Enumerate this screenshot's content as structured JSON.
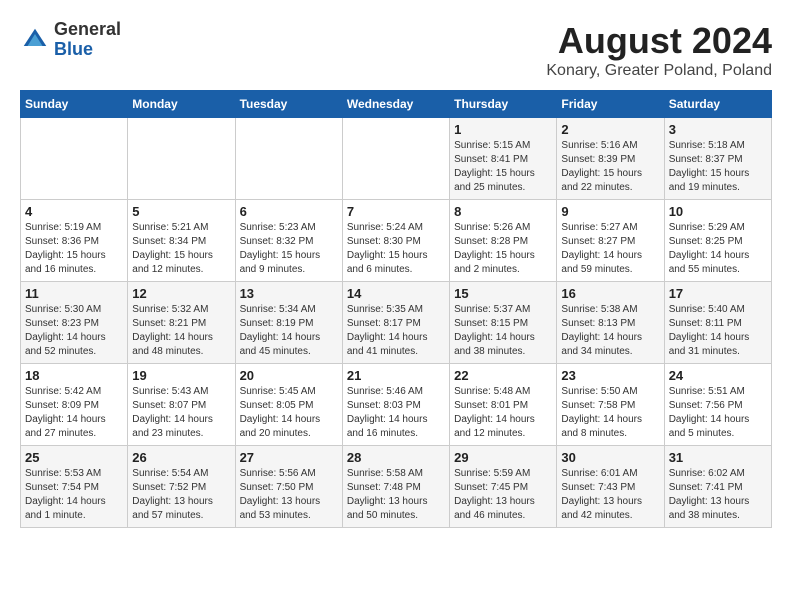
{
  "header": {
    "logo_general": "General",
    "logo_blue": "Blue",
    "title": "August 2024",
    "subtitle": "Konary, Greater Poland, Poland"
  },
  "columns": [
    "Sunday",
    "Monday",
    "Tuesday",
    "Wednesday",
    "Thursday",
    "Friday",
    "Saturday"
  ],
  "weeks": [
    [
      {
        "day": "",
        "info": ""
      },
      {
        "day": "",
        "info": ""
      },
      {
        "day": "",
        "info": ""
      },
      {
        "day": "",
        "info": ""
      },
      {
        "day": "1",
        "info": "Sunrise: 5:15 AM\nSunset: 8:41 PM\nDaylight: 15 hours\nand 25 minutes."
      },
      {
        "day": "2",
        "info": "Sunrise: 5:16 AM\nSunset: 8:39 PM\nDaylight: 15 hours\nand 22 minutes."
      },
      {
        "day": "3",
        "info": "Sunrise: 5:18 AM\nSunset: 8:37 PM\nDaylight: 15 hours\nand 19 minutes."
      }
    ],
    [
      {
        "day": "4",
        "info": "Sunrise: 5:19 AM\nSunset: 8:36 PM\nDaylight: 15 hours\nand 16 minutes."
      },
      {
        "day": "5",
        "info": "Sunrise: 5:21 AM\nSunset: 8:34 PM\nDaylight: 15 hours\nand 12 minutes."
      },
      {
        "day": "6",
        "info": "Sunrise: 5:23 AM\nSunset: 8:32 PM\nDaylight: 15 hours\nand 9 minutes."
      },
      {
        "day": "7",
        "info": "Sunrise: 5:24 AM\nSunset: 8:30 PM\nDaylight: 15 hours\nand 6 minutes."
      },
      {
        "day": "8",
        "info": "Sunrise: 5:26 AM\nSunset: 8:28 PM\nDaylight: 15 hours\nand 2 minutes."
      },
      {
        "day": "9",
        "info": "Sunrise: 5:27 AM\nSunset: 8:27 PM\nDaylight: 14 hours\nand 59 minutes."
      },
      {
        "day": "10",
        "info": "Sunrise: 5:29 AM\nSunset: 8:25 PM\nDaylight: 14 hours\nand 55 minutes."
      }
    ],
    [
      {
        "day": "11",
        "info": "Sunrise: 5:30 AM\nSunset: 8:23 PM\nDaylight: 14 hours\nand 52 minutes."
      },
      {
        "day": "12",
        "info": "Sunrise: 5:32 AM\nSunset: 8:21 PM\nDaylight: 14 hours\nand 48 minutes."
      },
      {
        "day": "13",
        "info": "Sunrise: 5:34 AM\nSunset: 8:19 PM\nDaylight: 14 hours\nand 45 minutes."
      },
      {
        "day": "14",
        "info": "Sunrise: 5:35 AM\nSunset: 8:17 PM\nDaylight: 14 hours\nand 41 minutes."
      },
      {
        "day": "15",
        "info": "Sunrise: 5:37 AM\nSunset: 8:15 PM\nDaylight: 14 hours\nand 38 minutes."
      },
      {
        "day": "16",
        "info": "Sunrise: 5:38 AM\nSunset: 8:13 PM\nDaylight: 14 hours\nand 34 minutes."
      },
      {
        "day": "17",
        "info": "Sunrise: 5:40 AM\nSunset: 8:11 PM\nDaylight: 14 hours\nand 31 minutes."
      }
    ],
    [
      {
        "day": "18",
        "info": "Sunrise: 5:42 AM\nSunset: 8:09 PM\nDaylight: 14 hours\nand 27 minutes."
      },
      {
        "day": "19",
        "info": "Sunrise: 5:43 AM\nSunset: 8:07 PM\nDaylight: 14 hours\nand 23 minutes."
      },
      {
        "day": "20",
        "info": "Sunrise: 5:45 AM\nSunset: 8:05 PM\nDaylight: 14 hours\nand 20 minutes."
      },
      {
        "day": "21",
        "info": "Sunrise: 5:46 AM\nSunset: 8:03 PM\nDaylight: 14 hours\nand 16 minutes."
      },
      {
        "day": "22",
        "info": "Sunrise: 5:48 AM\nSunset: 8:01 PM\nDaylight: 14 hours\nand 12 minutes."
      },
      {
        "day": "23",
        "info": "Sunrise: 5:50 AM\nSunset: 7:58 PM\nDaylight: 14 hours\nand 8 minutes."
      },
      {
        "day": "24",
        "info": "Sunrise: 5:51 AM\nSunset: 7:56 PM\nDaylight: 14 hours\nand 5 minutes."
      }
    ],
    [
      {
        "day": "25",
        "info": "Sunrise: 5:53 AM\nSunset: 7:54 PM\nDaylight: 14 hours\nand 1 minute."
      },
      {
        "day": "26",
        "info": "Sunrise: 5:54 AM\nSunset: 7:52 PM\nDaylight: 13 hours\nand 57 minutes."
      },
      {
        "day": "27",
        "info": "Sunrise: 5:56 AM\nSunset: 7:50 PM\nDaylight: 13 hours\nand 53 minutes."
      },
      {
        "day": "28",
        "info": "Sunrise: 5:58 AM\nSunset: 7:48 PM\nDaylight: 13 hours\nand 50 minutes."
      },
      {
        "day": "29",
        "info": "Sunrise: 5:59 AM\nSunset: 7:45 PM\nDaylight: 13 hours\nand 46 minutes."
      },
      {
        "day": "30",
        "info": "Sunrise: 6:01 AM\nSunset: 7:43 PM\nDaylight: 13 hours\nand 42 minutes."
      },
      {
        "day": "31",
        "info": "Sunrise: 6:02 AM\nSunset: 7:41 PM\nDaylight: 13 hours\nand 38 minutes."
      }
    ]
  ]
}
